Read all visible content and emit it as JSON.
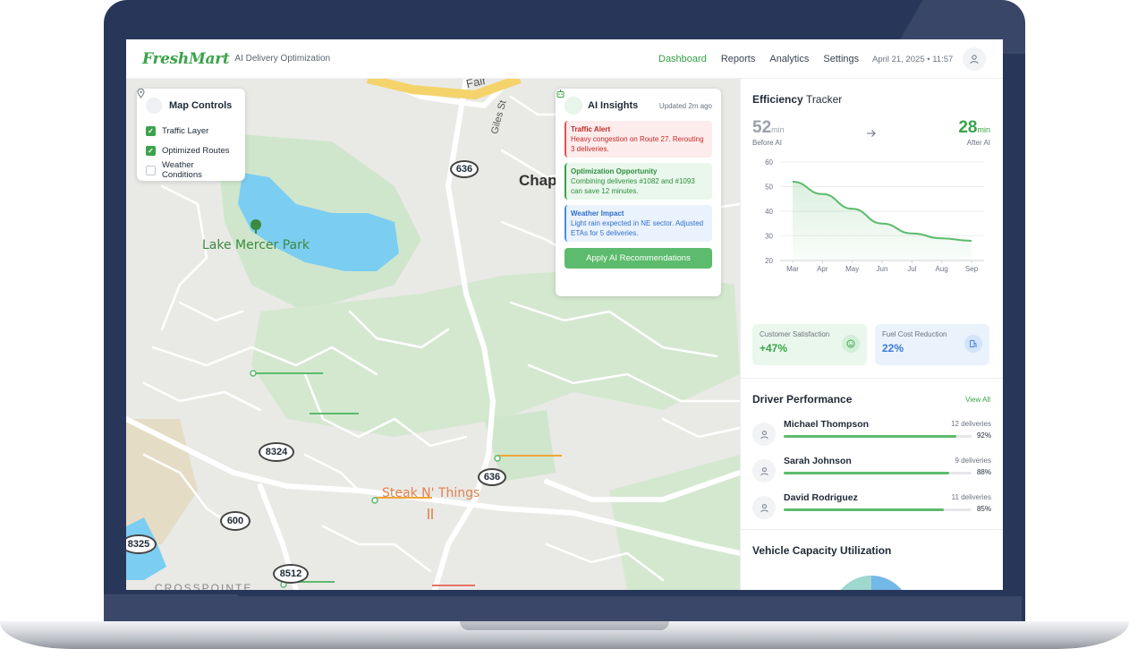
{
  "header": {
    "logo": "FreshMart",
    "subtitle": "AI Delivery Optimization",
    "nav": [
      "Dashboard",
      "Reports",
      "Analytics",
      "Settings"
    ],
    "active_nav": "Dashboard",
    "datetime": "April 21, 2025 • 11:57"
  },
  "map": {
    "labels": {
      "park": "Lake Mercer Park",
      "restaurant": "Steak N' Things",
      "street_giles": "Giles St",
      "street_fair": "Fair",
      "town_partial": "Chap",
      "area_partial": "CROSSPOINTE"
    },
    "road_shields": [
      "636",
      "636",
      "8324",
      "600",
      "8512",
      "8325"
    ],
    "controls": {
      "title": "Map Controls",
      "layers": [
        {
          "label": "Traffic Layer",
          "checked": true
        },
        {
          "label": "Optimized Routes",
          "checked": true
        },
        {
          "label": "Weather Conditions",
          "checked": false
        }
      ]
    },
    "ai_insights": {
      "title": "AI Insights",
      "updated": "Updated 2m ago",
      "alerts": [
        {
          "type": "red",
          "title": "Traffic Alert",
          "body": "Heavy congestion on Route 27. Rerouting 3 deliveries."
        },
        {
          "type": "green",
          "title": "Optimization Opportunity",
          "body": "Combining deliveries #1082 and #1093 can save 12 minutes."
        },
        {
          "type": "blue",
          "title": "Weather Impact",
          "body": "Light rain expected in NE sector. Adjusted ETAs for 5 deliveries."
        }
      ],
      "button": "Apply AI Recommendations"
    }
  },
  "efficiency": {
    "title_bold": "Efficiency",
    "title_light": "Tracker",
    "before_value": "52",
    "before_unit": "min",
    "before_label": "Before AI",
    "after_value": "28",
    "after_unit": "min",
    "after_label": "After AI",
    "colors": {
      "before": "#9aa1ab",
      "after": "#3aa34a"
    }
  },
  "chart_data": {
    "type": "area",
    "categories": [
      "Mar",
      "Apr",
      "May",
      "Jun",
      "Jul",
      "Aug",
      "Sep"
    ],
    "values": [
      52,
      47,
      41,
      35,
      31,
      29,
      28
    ],
    "ylim": [
      20,
      60
    ],
    "yticks": [
      20,
      30,
      40,
      50,
      60
    ],
    "title": "",
    "xlabel": "",
    "ylabel": "",
    "grid": true
  },
  "metrics": [
    {
      "label": "Customer Satisfaction",
      "value": "+47%",
      "icon": "smile-icon"
    },
    {
      "label": "Fuel Cost Reduction",
      "value": "22%",
      "icon": "fuel-icon"
    }
  ],
  "drivers": {
    "title": "Driver Performance",
    "view_all": "View All",
    "list": [
      {
        "name": "Michael Thompson",
        "deliveries": "12 deliveries",
        "pct_label": "92%",
        "pct": 92
      },
      {
        "name": "Sarah Johnson",
        "deliveries": "9 deliveries",
        "pct_label": "88%",
        "pct": 88
      },
      {
        "name": "David Rodriguez",
        "deliveries": "11 deliveries",
        "pct_label": "85%",
        "pct": 85
      }
    ]
  },
  "vehicle": {
    "title": "Vehicle Capacity Utilization"
  }
}
